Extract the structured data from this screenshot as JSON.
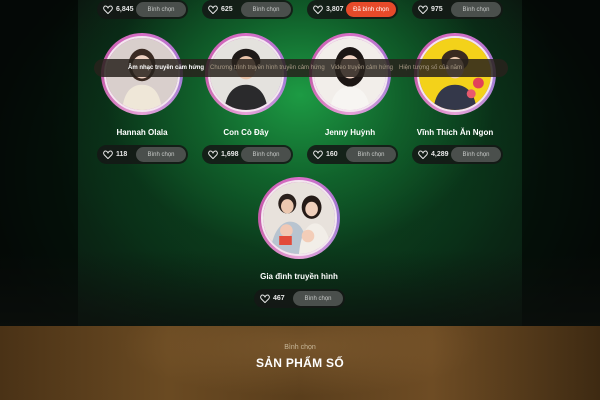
{
  "top_row": [
    {
      "count": "6,845",
      "button": "Bình chọn",
      "voted": false
    },
    {
      "count": "625",
      "button": "Bình chọn",
      "voted": false
    },
    {
      "count": "3,807",
      "button": "Đã bình chọn",
      "voted": true
    },
    {
      "count": "975",
      "button": "Bình chọn",
      "voted": false
    }
  ],
  "candidates": [
    {
      "name": "Hannah Olala",
      "count": "118",
      "button": "Bình chọn"
    },
    {
      "name": "Con Cò Đây",
      "count": "1,698",
      "button": "Bình chọn"
    },
    {
      "name": "Jenny Huỳnh",
      "count": "160",
      "button": "Bình chọn"
    },
    {
      "name": "Vĩnh Thích Ăn Ngon",
      "count": "4,289",
      "button": "Bình chọn"
    },
    {
      "name": "Gia đình truyền hình",
      "count": "467",
      "button": "Bình chọn"
    }
  ],
  "product": {
    "kicker": "Bình chọn",
    "title": "SẢN PHẨM SỐ",
    "tabs": [
      "Âm nhạc truyền cảm hứng",
      "Chương trình truyền hình truyền cảm hứng",
      "Video truyền cảm hứng",
      "Hiện tượng số của năm"
    ]
  },
  "colors": {
    "accent_voted": "#e64a2a",
    "avatar_ring": "#d86fc7",
    "bg_green": "#1ea046",
    "bg_gold": "#6a4a22"
  },
  "icons": {
    "vote_count": "heart-icon"
  }
}
